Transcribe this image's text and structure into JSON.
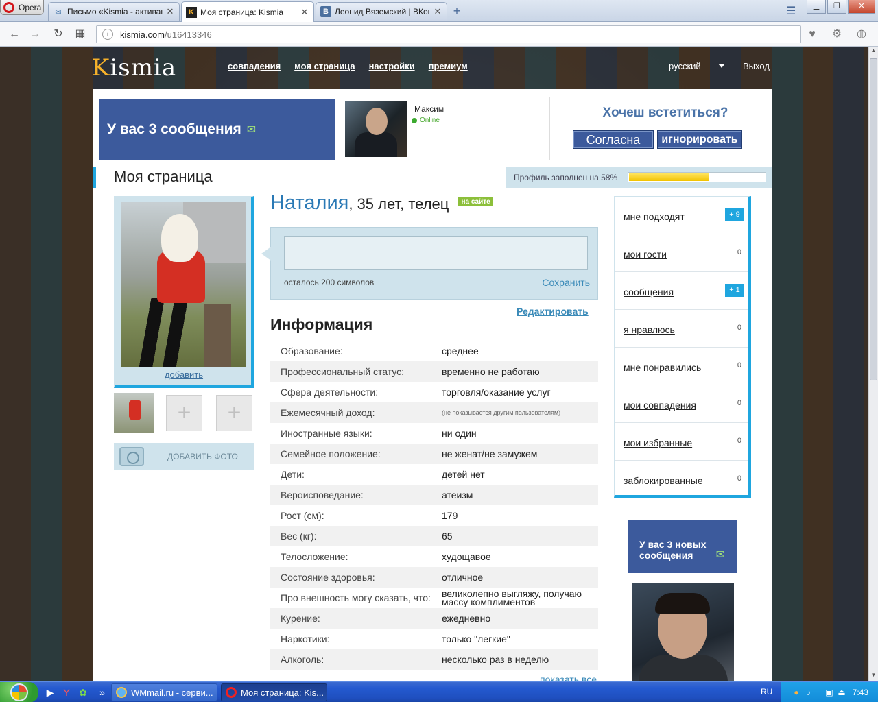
{
  "browser": {
    "menu_label": "Opera",
    "tabs": [
      {
        "title": "Письмо «Kismia - активац",
        "favicon": "mail-icon"
      },
      {
        "title": "Моя страница: Kismia",
        "favicon": "K",
        "active": true
      },
      {
        "title": "Леонид Вяземский | ВКон",
        "favicon": "B"
      }
    ],
    "url_host": "kismia.com",
    "url_path": "/u16413346"
  },
  "site": {
    "logo_k": "K",
    "logo_rest": "ismia",
    "nav": [
      "совпадения",
      "моя страница",
      "настройки",
      "премиум"
    ],
    "language": "русский",
    "logout": "Выход"
  },
  "banner": {
    "messages_text": "У вас 3 сообщения",
    "user_name": "Максим",
    "user_status": "Online",
    "meet_question": "Хочеш встетиться?",
    "agree_label": "Согласна",
    "ignore_label": "игнорировать"
  },
  "page": {
    "title": "Моя страница",
    "profile_fill_text": "Профиль заполнен на 58%",
    "profile_fill_fraction": 0.58
  },
  "photo": {
    "add_link": "добавить",
    "add_photo_label": "ДОБАВИТЬ ФОТО",
    "empty_slot_glyph": "+"
  },
  "profile": {
    "name": "Наталия",
    "details": ", 35 лет, телец",
    "online_badge": "на сайте",
    "status_chars_left": "осталось 200 символов",
    "save_label": "Сохранить",
    "edit_label": "Редактировать",
    "info_title": "Информация",
    "info": [
      {
        "k": "Образование:",
        "v": "среднее"
      },
      {
        "k": "Профессиональный статус:",
        "v": "временно не работаю"
      },
      {
        "k": "Сфера деятельности:",
        "v": "торговля/оказание услуг"
      },
      {
        "k": "Ежемесячный доход:",
        "v": "(не показывается другим пользователям)"
      },
      {
        "k": "Иностранные языки:",
        "v": "ни один"
      },
      {
        "k": "Семейное положение:",
        "v": "не женат/не замужем"
      },
      {
        "k": "Дети:",
        "v": "детей нет"
      },
      {
        "k": "Вероисповедание:",
        "v": "атеизм"
      },
      {
        "k": "Рост (см):",
        "v": "179"
      },
      {
        "k": "Вес (кг):",
        "v": "65"
      },
      {
        "k": "Телосложение:",
        "v": "худощавое"
      },
      {
        "k": "Состояние здоровья:",
        "v": "отличное"
      },
      {
        "k": "Про внешность могу сказать, что:",
        "v": "великолепно выгляжу, получаю массу комплиментов"
      },
      {
        "k": "Курение:",
        "v": "ежедневно"
      },
      {
        "k": "Наркотики:",
        "v": "только \"легкие\""
      },
      {
        "k": "Алкоголь:",
        "v": "несколько раз в неделю"
      }
    ],
    "show_all": "показать все"
  },
  "sidebar": {
    "items": [
      {
        "label": "мне подходят",
        "count": "+ 9",
        "highlight": true
      },
      {
        "label": "мои гости",
        "count": "0"
      },
      {
        "label": "сообщения",
        "count": "+ 1",
        "highlight": true
      },
      {
        "label": "я нравлюсь",
        "count": "0"
      },
      {
        "label": "мне понравились",
        "count": "0"
      },
      {
        "label": "мои совпадения",
        "count": "0"
      },
      {
        "label": "мои избранные",
        "count": "0"
      },
      {
        "label": "заблокированные",
        "count": "0"
      }
    ],
    "new_messages_line1": "У вас 3 новых",
    "new_messages_line2": "сообщения"
  },
  "taskbar": {
    "buttons": [
      {
        "title": "WMmail.ru - серви...",
        "icon": "ie-icon"
      },
      {
        "title": "Моя страница: Kis...",
        "icon": "opera-icon",
        "active": true
      }
    ],
    "language": "RU",
    "time": "7:43"
  }
}
